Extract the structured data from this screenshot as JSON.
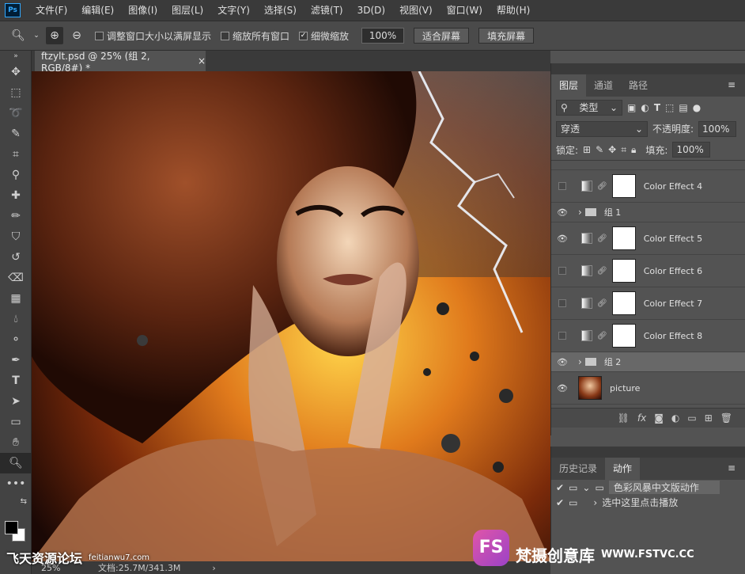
{
  "app": {
    "logo": "Ps"
  },
  "menubar": {
    "items": [
      "文件(F)",
      "编辑(E)",
      "图像(I)",
      "图层(L)",
      "文字(Y)",
      "选择(S)",
      "滤镜(T)",
      "3D(D)",
      "视图(V)",
      "窗口(W)",
      "帮助(H)"
    ]
  },
  "options": {
    "resize_windows": "调整窗口大小以满屏显示",
    "zoom_all": "缩放所有窗口",
    "scrubby_zoom": "细微缩放",
    "zoom_value": "100%",
    "fit_screen": "适合屏幕",
    "fill_screen": "填充屏幕"
  },
  "document": {
    "tab_title": "ftzylt.psd @ 25% (组 2, RGB/8#) *",
    "close": "×"
  },
  "status": {
    "zoom": "25%",
    "doc_size": "文档:25.7M/341.3M"
  },
  "layers_panel": {
    "tabs": [
      "图层",
      "通道",
      "路径"
    ],
    "filter_kind": "类型",
    "blend_mode": "穿透",
    "opacity_label": "不透明度:",
    "opacity_value": "100%",
    "lock_label": "锁定:",
    "fill_label": "填充:",
    "fill_value": "100%",
    "layers": [
      {
        "name": "Color Effect 4",
        "visible": false
      },
      {
        "name": "组 1",
        "visible": true,
        "group": true
      },
      {
        "name": "Color Effect 5",
        "visible": true
      },
      {
        "name": "Color Effect 6",
        "visible": false
      },
      {
        "name": "Color Effect 7",
        "visible": false
      },
      {
        "name": "Color Effect 8",
        "visible": false
      },
      {
        "name": "组 2",
        "visible": true,
        "group": true,
        "selected": true
      },
      {
        "name": "picture",
        "visible": true
      }
    ],
    "bottom_icons": [
      "link-icon",
      "fx-icon",
      "mask-icon",
      "adjustment-icon",
      "folder-icon",
      "new-layer-icon",
      "trash-icon"
    ],
    "bottom_labels": {
      "fx": "fx"
    }
  },
  "actions_panel": {
    "tabs": [
      "历史记录",
      "动作"
    ],
    "items": [
      "色彩风暴中文版动作",
      "选中这里点击播放"
    ]
  },
  "watermarks": {
    "left": "飞天资源论坛",
    "left_url": "feitianwu7.com",
    "right_logo": "FS",
    "right_text": "梵摄创意库",
    "right_url": "WWW.FSTVC.CC"
  },
  "colors": {
    "accent": "#31a8ff",
    "panel": "#535353",
    "menubar": "#3a3a3a"
  }
}
